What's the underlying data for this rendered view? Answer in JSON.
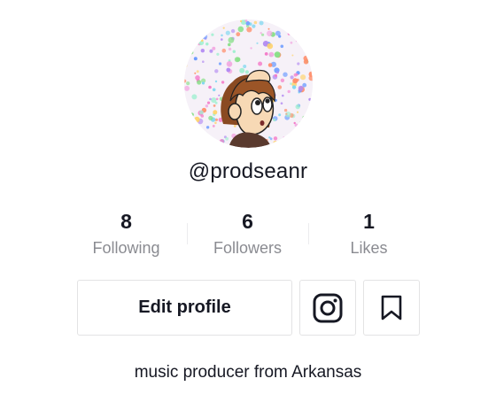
{
  "profile": {
    "username": "@prodseanr",
    "bio": "music producer from Arkansas"
  },
  "stats": {
    "following": {
      "value": "8",
      "label": "Following"
    },
    "followers": {
      "value": "6",
      "label": "Followers"
    },
    "likes": {
      "value": "1",
      "label": "Likes"
    }
  },
  "actions": {
    "edit_label": "Edit profile",
    "instagram_icon": "instagram-icon",
    "bookmark_icon": "bookmark-icon"
  },
  "colors": {
    "text_primary": "#161823",
    "text_secondary": "#8a8b91",
    "border": "#e3e3e4"
  }
}
